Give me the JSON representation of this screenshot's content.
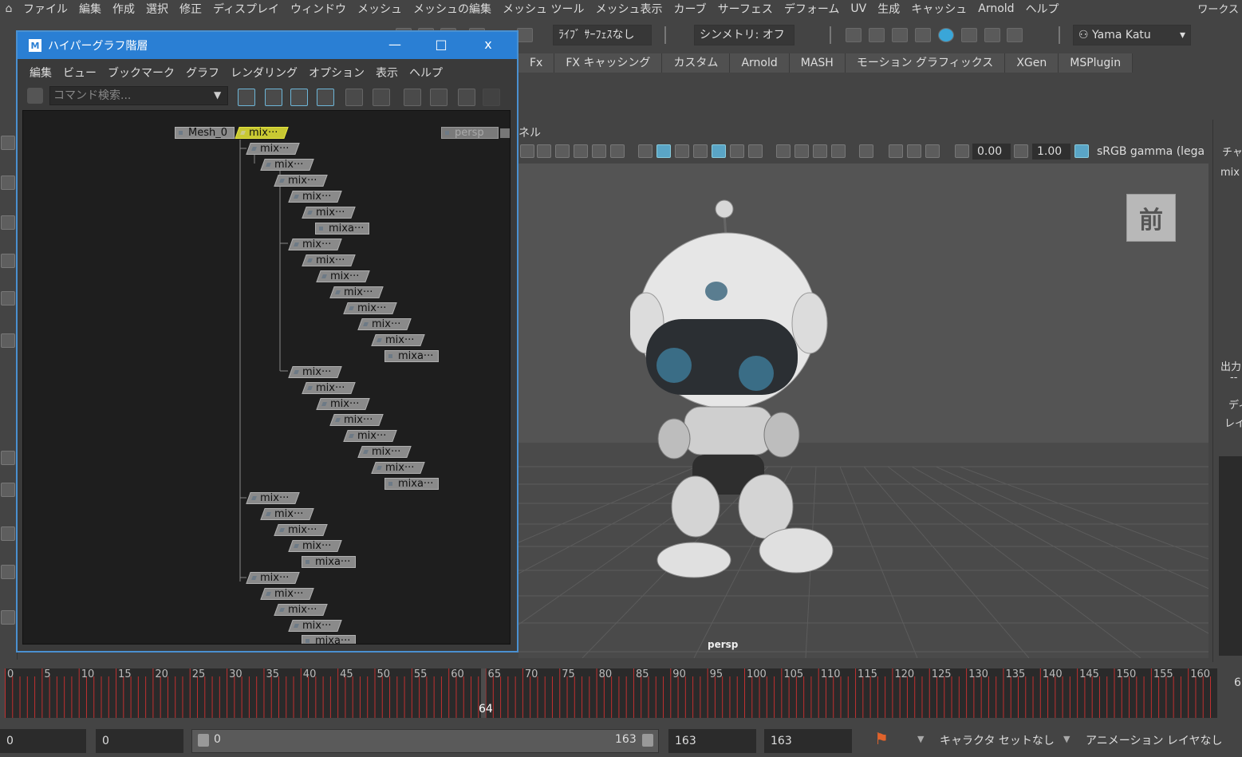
{
  "menubar": {
    "items": [
      "ファイル",
      "編集",
      "作成",
      "選択",
      "修正",
      "ディスプレイ",
      "ウィンドウ",
      "メッシュ",
      "メッシュの編集",
      "メッシュ ツール",
      "メッシュ表示",
      "カーブ",
      "サーフェス",
      "デフォーム",
      "UV",
      "生成",
      "キャッシュ",
      "Arnold",
      "ヘルプ"
    ],
    "workspace": "ワークス"
  },
  "statusline": {
    "live_surface": "ﾗｲﾌﾞ ｻｰﾌｪｽなし",
    "symmetry": "シンメトリ: オフ",
    "user": "Yama Katu"
  },
  "shelf": {
    "tabs": [
      "Fx",
      "FX キャッシング",
      "カスタム",
      "Arnold",
      "MASH",
      "モーション グラフィックス",
      "XGen",
      "MSPlugin"
    ]
  },
  "viewport": {
    "panel_label": "ネル",
    "exposure": "0.00",
    "gamma": "1.00",
    "color_space": "sRGB gamma (lega",
    "view_cube_label": "前",
    "camera": "persp"
  },
  "channel_box": {
    "label_top": "チャ",
    "object": "mix",
    "output": "出力",
    "output_sub": "--",
    "display1": "ディ",
    "display2": "レイ"
  },
  "hypergraph": {
    "title": "ハイパーグラフ階層",
    "logo": "M",
    "minimize": "—",
    "maximize": "□",
    "close": "x",
    "menu": [
      "編集",
      "ビュー",
      "ブックマーク",
      "グラフ",
      "レンダリング",
      "オプション",
      "表示",
      "ヘルプ"
    ],
    "search_placeholder": "コマンド検索...",
    "root_node": "Mesh_0",
    "selected_node": "mix···",
    "camera_node": "persp",
    "node_short": "mix···",
    "node_leaf": "mixa···"
  },
  "timeslider": {
    "ticks": [
      "0",
      "5",
      "10",
      "15",
      "20",
      "25",
      "30",
      "35",
      "40",
      "45",
      "50",
      "55",
      "60",
      "65",
      "70",
      "75",
      "80",
      "85",
      "90",
      "95",
      "100",
      "105",
      "110",
      "115",
      "120",
      "125",
      "130",
      "135",
      "140",
      "145",
      "150",
      "155",
      "160"
    ],
    "current_frame": "64",
    "right_edge": "6"
  },
  "range": {
    "start": "0",
    "playback_start": "0",
    "slider_start": "0",
    "slider_end": "163",
    "playback_end": "163",
    "end": "163",
    "character_set": "キャラクタ セットなし",
    "anim_layer": "アニメーション レイヤなし"
  },
  "colors": {
    "accent_blue": "#2a7fd4",
    "selected_node": "#c8c832",
    "timeline_tick": "#c03030"
  }
}
